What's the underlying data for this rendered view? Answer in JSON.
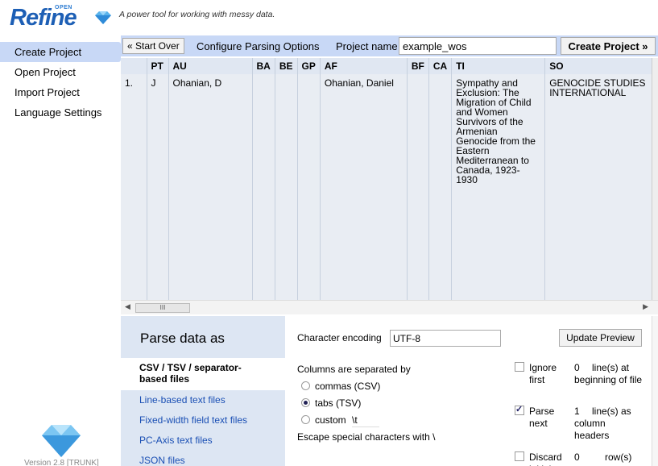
{
  "header": {
    "logo_small": "OPEN",
    "logo_word": "Refine",
    "tagline": "A power tool for working with messy data."
  },
  "sidebar": {
    "items": [
      {
        "label": "Create Project"
      },
      {
        "label": "Open Project"
      },
      {
        "label": "Import Project"
      },
      {
        "label": "Language Settings"
      }
    ],
    "version": "Version 2.8 [TRUNK]"
  },
  "toolbar": {
    "start_over": "« Start Over",
    "configure": "Configure Parsing Options",
    "project_name_label": "Project name",
    "project_name_value": "example_wos",
    "create_project": "Create Project »"
  },
  "preview": {
    "columns": [
      "",
      "PT",
      "AU",
      "BA",
      "BE",
      "GP",
      "AF",
      "BF",
      "CA",
      "TI",
      "SO"
    ],
    "row": {
      "index": "1.",
      "PT": "J",
      "AU": "Ohanian, D",
      "BA": "",
      "BE": "",
      "GP": "",
      "AF": "Ohanian, Daniel",
      "BF": "",
      "CA": "",
      "TI": "Sympathy and Exclusion: The Migration of Child and Women Survivors of the Armenian Genocide from the Eastern Mediterranean to Canada, 1923-1930",
      "SO": "GENOCIDE STUDIES INTERNATIONAL"
    },
    "scroll_thumb": "III"
  },
  "parse": {
    "heading": "Parse data as",
    "formats": [
      {
        "label": "CSV / TSV / separator-based files"
      },
      {
        "label": "Line-based text files"
      },
      {
        "label": "Fixed-width field text files"
      },
      {
        "label": "PC-Axis text files"
      },
      {
        "label": "JSON files"
      }
    ],
    "encoding_label": "Character encoding",
    "encoding_value": "UTF-8",
    "update_preview": "Update Preview",
    "separator_label": "Columns are separated by",
    "separators": [
      {
        "label": "commas (CSV)",
        "selected": false
      },
      {
        "label": "tabs (TSV)",
        "selected": true
      },
      {
        "label": "custom",
        "selected": false
      }
    ],
    "custom_value": "\\t",
    "escape_label": "Escape special characters with \\",
    "options": [
      {
        "label": "Ignore first",
        "checked": false,
        "value": "0",
        "desc": "line(s) at beginning of file"
      },
      {
        "label": "Parse next",
        "checked": true,
        "value": "1",
        "desc": "line(s) as column headers"
      },
      {
        "label": "Discard initial",
        "checked": false,
        "value": "0",
        "desc": "row(s)"
      }
    ]
  },
  "colors": {
    "accent_bg": "#c8d8f6",
    "panel_bg": "#dde6f3",
    "link": "#1a4fb4",
    "logo": "#1d5fb5"
  }
}
